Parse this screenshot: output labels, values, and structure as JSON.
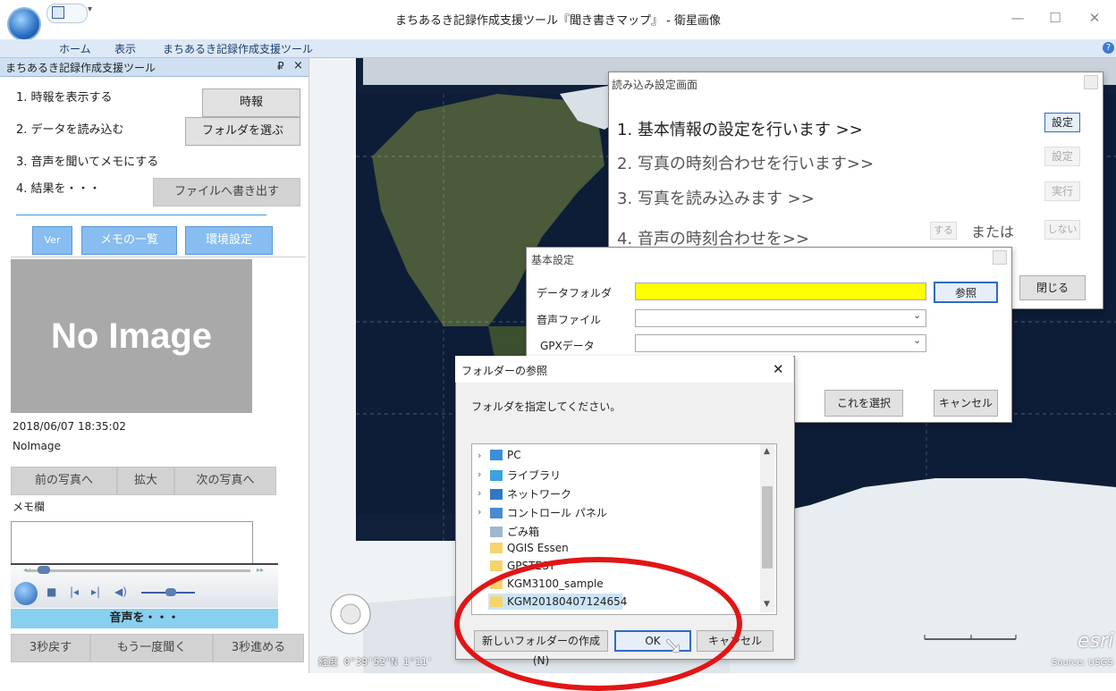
{
  "window": {
    "title": "まちあるき記録作成支援ツール『聞き書きマップ』 - 衛星画像",
    "min": "—",
    "max": "☐",
    "close": "✕"
  },
  "ribbon": {
    "tabs": [
      "ホーム",
      "表示",
      "まちあるき記録作成支援ツール"
    ],
    "help": "?"
  },
  "panel": {
    "title": "まちあるき記録作成支援ツール",
    "pin": "₽",
    "close": "×",
    "steps": [
      "1. 時報を表示する",
      "2. データを読み込む",
      "3. 音声を聞いてメモにする",
      "4. 結果を・・・"
    ],
    "buttons": {
      "jiho": "時報",
      "folder": "フォルダを選ぶ",
      "export": "ファイルへ書き出す",
      "ver": "Ver",
      "memo_list": "メモの一覧",
      "settings": "環境設定"
    },
    "image_placeholder": "No Image",
    "timestamp": "2018/06/07 18:35:02",
    "image_name": "NoImage",
    "photo_nav": {
      "prev": "前の写真へ",
      "zoom": "拡大",
      "next": "次の写真へ"
    },
    "memo_label": "メモ欄",
    "audio_label": "音声を・・・",
    "audio_nav": {
      "back": "3秒戻す",
      "again": "もう一度聞く",
      "forward": "3秒進める"
    }
  },
  "map": {
    "coords": "経度 0°39'52\"N  1°11'",
    "source": "Source: USGS",
    "brand": "esri"
  },
  "load_dialog": {
    "title": "読み込み設定画面",
    "steps": [
      "1. 基本情報の設定を行います >>",
      "2. 写真の時刻合わせを行います>>",
      "3. 写真を読み込みます          >>",
      "4. 音声の時刻合わせを>>"
    ],
    "buttons": {
      "set1": "設定",
      "set2": "設定",
      "run": "実行",
      "do": "する",
      "or": "または",
      "dont": "しない",
      "close": "閉じる"
    }
  },
  "basic_dialog": {
    "title": "基本設定",
    "labels": {
      "data_folder": "データフォルダ",
      "audio_file": "音声ファイル",
      "gpx": "GPXデータ"
    },
    "buttons": {
      "browse": "参照",
      "select": "これを選択",
      "cancel": "キャンセル"
    },
    "data_folder_value": ""
  },
  "folder_dialog": {
    "title": "フォルダーの参照",
    "close": "✕",
    "prompt": "フォルダを指定してください。",
    "tree": [
      "PC",
      "ライブラリ",
      "ネットワーク",
      "コントロール パネル",
      "ごみ箱",
      "QGIS Essen",
      "GPSTEST",
      "KGM3100_sample",
      "KGM20180407124654"
    ],
    "buttons": {
      "new_folder": "新しいフォルダーの作成(N)",
      "ok": "OK",
      "cancel": "キャンセル"
    },
    "selected": "KGM20180407124654"
  }
}
